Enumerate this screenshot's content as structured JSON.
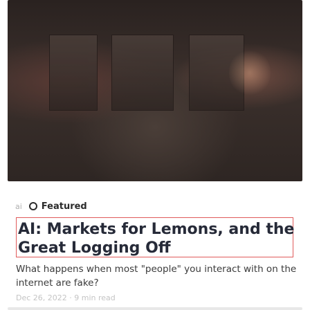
{
  "publication": {
    "logo_text": "ai"
  },
  "post": {
    "badge": "Featured",
    "title": "AI: Markets for Lemons, and the Great Logging Off",
    "subtitle": "What happens when most \"people\" you interact with on the internet are fake?",
    "meta": "Dec 26, 2022 · 9 min read"
  },
  "icons": {
    "featured": "circle-icon"
  }
}
